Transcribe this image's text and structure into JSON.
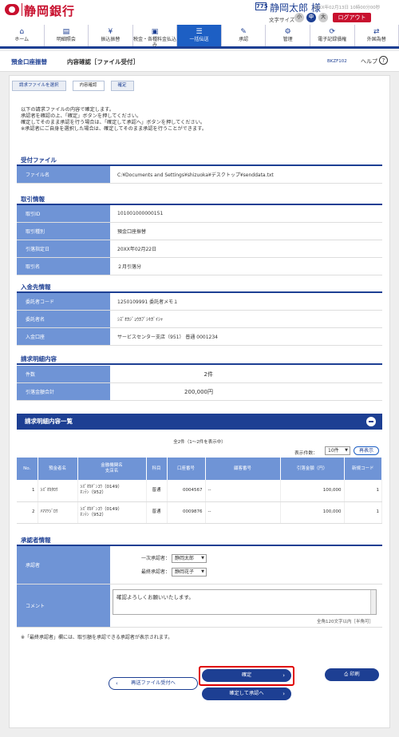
{
  "header": {
    "bank_name": "静岡銀行",
    "user_badge": "775",
    "user_name": "静岡太郎 様",
    "last_login": "20XX年02月13日 10時00分00秒",
    "text_size_label": "文字サイズ",
    "text_sizes": [
      "小",
      "中",
      "大"
    ],
    "logout_label": "ログアウト"
  },
  "nav": {
    "items": [
      {
        "label": "ホーム",
        "icon": "home-icon"
      },
      {
        "label": "明細照会",
        "icon": "document-list-icon"
      },
      {
        "label": "振込振替",
        "icon": "yen-transfer-icon"
      },
      {
        "label": "税金・各種料金払込み",
        "icon": "tax-payment-icon"
      },
      {
        "label": "一括伝送",
        "icon": "database-icon",
        "active": true
      },
      {
        "label": "承認",
        "icon": "approval-icon"
      },
      {
        "label": "管理",
        "icon": "management-icon"
      },
      {
        "label": "電子記録債権",
        "icon": "e-receivable-icon"
      },
      {
        "label": "外国為替",
        "icon": "foreign-exchange-icon"
      }
    ]
  },
  "titlebar": {
    "category": "預金口座振替",
    "title": "内容確認［ファイル受付］",
    "screen_code": "BKZF102",
    "help_label": "ヘルプ"
  },
  "steps": [
    "請求ファイルを選択",
    "内容確認",
    "確定"
  ],
  "intro": [
    "以下の請求ファイルの内容で確定します。",
    "承認者を確認の上、「確定」ボタンを押してください。",
    "確定してそのまま承認を行う場合は、「確定して承認へ」ボタンを押してください。",
    "※承認者にご自身を選択した場合は、確定してそのまま承認を行うことができます。"
  ],
  "file_section": {
    "heading": "受付ファイル",
    "rows": [
      {
        "label": "ファイル名",
        "value": "C:¥Documents and Settings¥shizuoka¥デスクトップ¥senddata.txt"
      }
    ]
  },
  "transaction_section": {
    "heading": "取引情報",
    "rows": [
      {
        "label": "取引ID",
        "value": "101001000000151"
      },
      {
        "label": "取引種別",
        "value": "預金口座振替"
      },
      {
        "label": "引落指定日",
        "value": "20XX年02月22日"
      },
      {
        "label": "取引名",
        "value": "２月引落分"
      }
    ]
  },
  "deposit_section": {
    "heading": "入金先情報",
    "rows": [
      {
        "label": "委託者コード",
        "value": "1250109991 委託者メモ１"
      },
      {
        "label": "委託者名",
        "value": "ｼｽﾞｵｶｼﾞｮｳｶﾌﾞｼｷｶﾞｲｼｬ"
      },
      {
        "label": "入金口座",
        "value": "サービスセンター支店（951） 普通 0001234"
      }
    ]
  },
  "summary_section": {
    "heading": "請求明細内容",
    "rows": [
      {
        "label": "件数",
        "value": "2件"
      },
      {
        "label": "引落金額合計",
        "value": "200,000円"
      }
    ]
  },
  "list_section": {
    "heading": "請求明細内容一覧",
    "pager": "全2件（1～2件を表示中）",
    "display_count_label": "表示件数：",
    "display_count_value": "10件",
    "redisplay_label": "再表示",
    "columns": [
      "No.",
      "預金者名",
      "金融機関名\n支店名",
      "科目",
      "口座番号",
      "顧客番号",
      "引落金額（円）",
      "新規コード"
    ],
    "rows": [
      {
        "no": "1",
        "name": "ｼｽﾞｵｶﾀﾛｳ",
        "bank": "ｼｽﾞｵｶｷﾞﾝｺｳ（0149）",
        "branch": "ﾎﾝﾃﾝ（952）",
        "subject": "普通",
        "account": "0004567",
        "customer": "--",
        "amount": "100,000",
        "code": "1"
      },
      {
        "no": "2",
        "name": "ﾊﾏﾏﾂｼﾞﾛｳ",
        "bank": "ｼｽﾞｵｶｷﾞﾝｺｳ（0149）",
        "branch": "ﾎﾝﾃﾝ（952）",
        "subject": "普通",
        "account": "0009876",
        "customer": "--",
        "amount": "100,000",
        "code": "1"
      }
    ]
  },
  "approver_section": {
    "heading": "承認者情報",
    "approver_label": "承認者",
    "first_label": "一次承認者：",
    "first_value": "静岡太郎",
    "final_label": "最終承認者：",
    "final_value": "静岡花子",
    "comment_label": "コメント",
    "comment_value": "確認よろしくお願いいたします。",
    "counter": "全角120文字以内［半角可］"
  },
  "note": "※「最終承認者」欄には、取引額を承認できる承認者が表示されます。",
  "buttons": {
    "back": "再送ファイル受付へ",
    "confirm": "確定",
    "confirm_approve": "確定して承認へ",
    "print": "印刷"
  },
  "colors": {
    "brand_red": "#c8102e",
    "navy": "#1d3f93",
    "label_blue": "#6f94d6",
    "highlight": "#e00000"
  }
}
